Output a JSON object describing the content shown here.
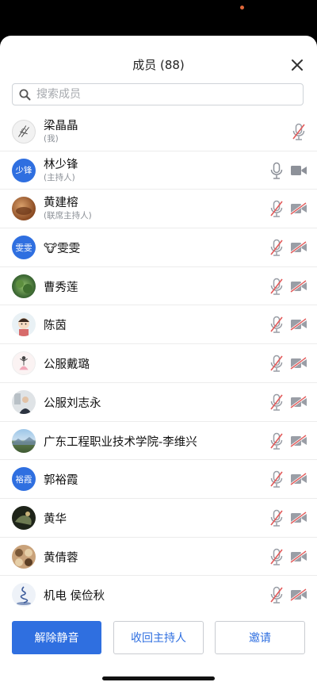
{
  "header": {
    "title": "成员 (88)"
  },
  "search": {
    "placeholder": "搜索成员"
  },
  "members": [
    {
      "name": "梁晶晶",
      "role": "(我)",
      "avatar": "sketch",
      "mic": "muted",
      "cam": "none"
    },
    {
      "name": "林少锋",
      "role": "(主持人)",
      "avatar_text": "少锋",
      "mic": "on",
      "cam": "on"
    },
    {
      "name": "黄建榕",
      "role": "(联席主持人)",
      "avatar": "wood",
      "mic": "muted",
      "cam": "off"
    },
    {
      "name": "🐮雯雯",
      "avatar_text": "雯雯",
      "mic": "muted",
      "cam": "off"
    },
    {
      "name": "曹秀莲",
      "avatar": "lotus",
      "mic": "muted",
      "cam": "off"
    },
    {
      "name": "陈茵",
      "avatar": "cartoon",
      "mic": "muted",
      "cam": "off"
    },
    {
      "name": "公服戴璐",
      "avatar": "dancer",
      "mic": "muted",
      "cam": "off"
    },
    {
      "name": "公服刘志永",
      "avatar": "person",
      "mic": "muted",
      "cam": "off"
    },
    {
      "name": "广东工程职业技术学院-李维兴",
      "avatar": "landscape",
      "mic": "muted",
      "cam": "off"
    },
    {
      "name": "郭裕霞",
      "avatar_text": "裕霞",
      "mic": "muted",
      "cam": "off"
    },
    {
      "name": "黄华",
      "avatar": "dark",
      "mic": "muted",
      "cam": "off"
    },
    {
      "name": "黄倩蓉",
      "avatar": "cats",
      "mic": "muted",
      "cam": "off"
    },
    {
      "name": "机电 侯俭秋",
      "avatar": "swirl",
      "mic": "muted",
      "cam": "off"
    }
  ],
  "footer": {
    "unmute_label": "解除静音",
    "revoke_host_label": "收回主持人",
    "invite_label": "邀请"
  },
  "colors": {
    "accent": "#2f6fe0",
    "muted_red": "#e25a5a",
    "icon_gray": "#9a9ea6"
  }
}
